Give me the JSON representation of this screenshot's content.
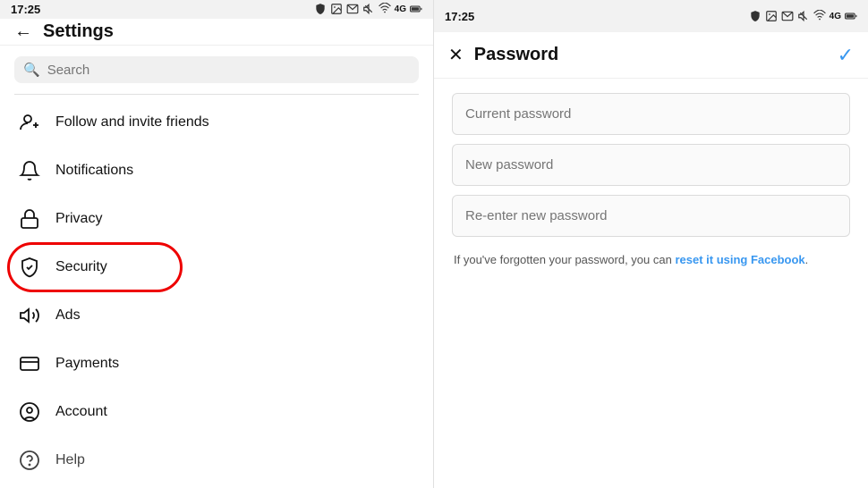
{
  "left": {
    "statusBar": {
      "time": "17:25",
      "icons": [
        "shield",
        "image",
        "mail",
        "mute",
        "wifi",
        "signal-bars",
        "battery"
      ]
    },
    "header": {
      "backLabel": "←",
      "title": "Settings"
    },
    "search": {
      "placeholder": "Search"
    },
    "menuItems": [
      {
        "id": "follow",
        "label": "Follow and invite friends",
        "icon": "person-add"
      },
      {
        "id": "notifications",
        "label": "Notifications",
        "icon": "bell"
      },
      {
        "id": "privacy",
        "label": "Privacy",
        "icon": "lock"
      },
      {
        "id": "security",
        "label": "Security",
        "icon": "shield",
        "highlighted": true
      },
      {
        "id": "ads",
        "label": "Ads",
        "icon": "megaphone"
      },
      {
        "id": "payments",
        "label": "Payments",
        "icon": "card"
      },
      {
        "id": "account",
        "label": "Account",
        "icon": "circle-person"
      },
      {
        "id": "help",
        "label": "Help",
        "icon": "circle-question"
      }
    ]
  },
  "right": {
    "statusBar": {
      "time": "17:25",
      "icons": [
        "shield",
        "image",
        "mail",
        "mute",
        "wifi",
        "signal-bars",
        "battery"
      ]
    },
    "header": {
      "closeLabel": "✕",
      "title": "Password",
      "checkLabel": "✓"
    },
    "form": {
      "currentPasswordPlaceholder": "Current password",
      "newPasswordPlaceholder": "New password",
      "reenterPlaceholder": "Re-enter new password",
      "forgotText": "If you've forgotten your password, you can ",
      "forgotLinkText": "reset it using Facebook",
      "forgotTextEnd": "."
    }
  }
}
